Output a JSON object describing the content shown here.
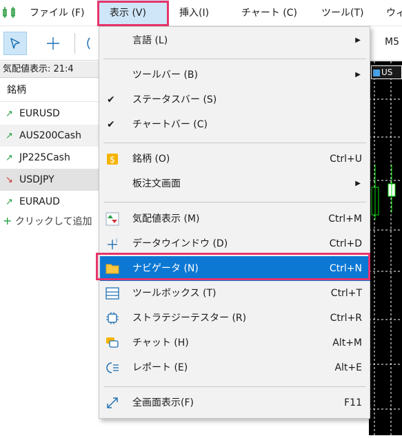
{
  "menubar": {
    "items": [
      {
        "label": "ファイル (F)"
      },
      {
        "label": "表示 (V)"
      },
      {
        "label": "挿入(I)"
      },
      {
        "label": "チャート (C)"
      },
      {
        "label": "ツール(T)"
      },
      {
        "label": "ウィ"
      }
    ]
  },
  "toolbar": {
    "timeframe_label": "M5"
  },
  "market_watch": {
    "header": "気配値表示: 21:4",
    "column_label": "銘柄",
    "rows": [
      {
        "symbol": "EURUSD",
        "direction": "up"
      },
      {
        "symbol": "AUS200Cash",
        "direction": "up"
      },
      {
        "symbol": "JP225Cash",
        "direction": "up"
      },
      {
        "symbol": "USDJPY",
        "direction": "down"
      },
      {
        "symbol": "EURAUD",
        "direction": "up"
      }
    ],
    "add_label": "クリックして追加"
  },
  "chart": {
    "tab_label": "US"
  },
  "view_menu": {
    "items": [
      {
        "label": "言語 (L)",
        "shortcut": "",
        "submenu": true
      },
      {
        "label": "ツールバー (B)",
        "shortcut": "",
        "submenu": true
      },
      {
        "label": "ステータスバー (S)",
        "shortcut": "",
        "checked": true
      },
      {
        "label": "チャートバー (C)",
        "shortcut": "",
        "checked": true
      },
      {
        "label": "銘柄 (O)",
        "shortcut": "Ctrl+U",
        "icon": "dollar-icon"
      },
      {
        "label": "板注文画面",
        "shortcut": "",
        "submenu": true
      },
      {
        "label": "気配値表示 (M)",
        "shortcut": "Ctrl+M",
        "icon": "market-watch-icon"
      },
      {
        "label": "データウインドウ (D)",
        "shortcut": "Ctrl+D",
        "icon": "crosshair-icon"
      },
      {
        "label": "ナビゲータ (N)",
        "shortcut": "Ctrl+N",
        "icon": "folder-icon",
        "highlighted": true
      },
      {
        "label": "ツールボックス (T)",
        "shortcut": "Ctrl+T",
        "icon": "toolbox-icon"
      },
      {
        "label": "ストラテジーテスター (R)",
        "shortcut": "Ctrl+R",
        "icon": "chip-icon"
      },
      {
        "label": "チャット (H)",
        "shortcut": "Alt+M",
        "icon": "chat-icon"
      },
      {
        "label": "レポート (E)",
        "shortcut": "Alt+E",
        "icon": "report-icon"
      },
      {
        "label": "全画面表示(F)",
        "shortcut": "F11",
        "icon": "fullscreen-icon"
      }
    ]
  },
  "colors": {
    "highlight_border": "#e8336b",
    "menu_hover": "#0c78d4",
    "up": "#20a040",
    "down": "#d03030"
  }
}
